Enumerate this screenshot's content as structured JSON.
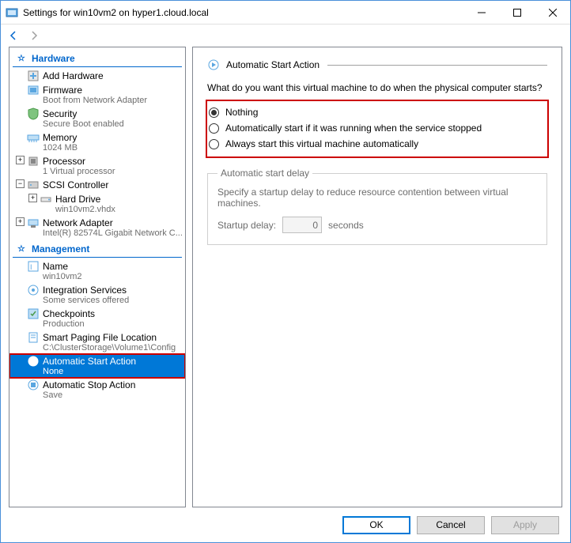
{
  "window": {
    "title": "Settings for win10vm2 on hyper1.cloud.local"
  },
  "tree": {
    "hardware_header": "Hardware",
    "add_hardware": "Add Hardware",
    "firmware": {
      "label": "Firmware",
      "sub": "Boot from Network Adapter"
    },
    "security": {
      "label": "Security",
      "sub": "Secure Boot enabled"
    },
    "memory": {
      "label": "Memory",
      "sub": "1024 MB"
    },
    "processor": {
      "label": "Processor",
      "sub": "1 Virtual processor"
    },
    "scsi": {
      "label": "SCSI Controller"
    },
    "hard_drive": {
      "label": "Hard Drive",
      "sub": "win10vm2.vhdx"
    },
    "network": {
      "label": "Network Adapter",
      "sub": "Intel(R) 82574L Gigabit Network C..."
    },
    "management_header": "Management",
    "name": {
      "label": "Name",
      "sub": "win10vm2"
    },
    "integration": {
      "label": "Integration Services",
      "sub": "Some services offered"
    },
    "checkpoints": {
      "label": "Checkpoints",
      "sub": "Production"
    },
    "paging": {
      "label": "Smart Paging File Location",
      "sub": "C:\\ClusterStorage\\Volume1\\Config"
    },
    "auto_start": {
      "label": "Automatic Start Action",
      "sub": "None"
    },
    "auto_stop": {
      "label": "Automatic Stop Action",
      "sub": "Save"
    }
  },
  "content": {
    "header": "Automatic Start Action",
    "prompt": "What do you want this virtual machine to do when the physical computer starts?",
    "opt_nothing": "Nothing",
    "opt_auto_running": "Automatically start if it was running when the service stopped",
    "opt_always": "Always start this virtual machine automatically",
    "delay_legend": "Automatic start delay",
    "delay_desc": "Specify a startup delay to reduce resource contention between virtual machines.",
    "delay_label": "Startup delay:",
    "delay_value": "0",
    "delay_unit": "seconds"
  },
  "buttons": {
    "ok": "OK",
    "cancel": "Cancel",
    "apply": "Apply"
  }
}
